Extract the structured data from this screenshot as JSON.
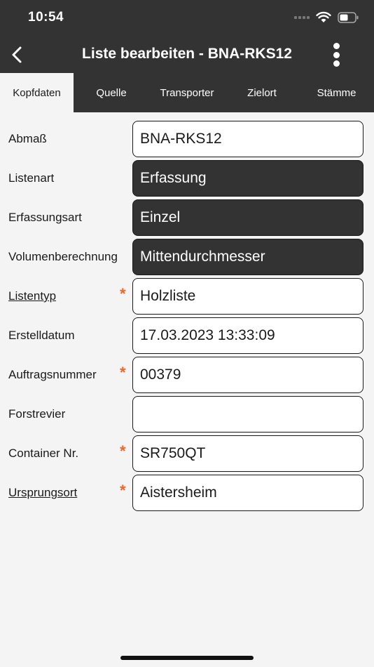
{
  "status_bar": {
    "time": "10:54"
  },
  "nav": {
    "title": "Liste bearbeiten - BNA-RKS12"
  },
  "tabs": [
    {
      "label": "Kopfdaten",
      "active": true
    },
    {
      "label": "Quelle",
      "active": false
    },
    {
      "label": "Transporter",
      "active": false
    },
    {
      "label": "Zielort",
      "active": false
    },
    {
      "label": "Stämme",
      "active": false
    }
  ],
  "form": {
    "rows": [
      {
        "label": "Abmaß",
        "value": "BNA-RKS12",
        "required": false,
        "link": false,
        "readonly": false
      },
      {
        "label": "Listenart",
        "value": "Erfassung",
        "required": false,
        "link": false,
        "readonly": true
      },
      {
        "label": "Erfassungsart",
        "value": "Einzel",
        "required": false,
        "link": false,
        "readonly": true
      },
      {
        "label": "Volumenberechnung",
        "value": "Mittendurchmesser",
        "required": false,
        "link": false,
        "readonly": true
      },
      {
        "label": "Listentyp",
        "value": "Holzliste",
        "required": true,
        "link": true,
        "readonly": false
      },
      {
        "label": "Erstelldatum",
        "value": "17.03.2023 13:33:09",
        "required": false,
        "link": false,
        "readonly": false
      },
      {
        "label": "Auftragsnummer",
        "value": "00379",
        "required": true,
        "link": false,
        "readonly": false
      },
      {
        "label": "Forstrevier",
        "value": "",
        "required": false,
        "link": false,
        "readonly": false
      },
      {
        "label": "Container Nr.",
        "value": "SR750QT",
        "required": true,
        "link": false,
        "readonly": false
      },
      {
        "label": "Ursprungsort",
        "value": "Aistersheim",
        "required": true,
        "link": true,
        "readonly": false
      }
    ],
    "required_marker": "*"
  },
  "colors": {
    "header_bg": "#333333",
    "page_bg": "#f4f4f4",
    "required": "#e8692a"
  }
}
